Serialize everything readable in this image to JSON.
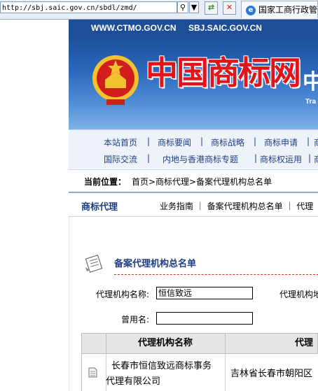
{
  "browser": {
    "address": "http://sbj.saic.gov.cn/sbdl/zmd/",
    "tab_title": "国家工商行政管理总局"
  },
  "header": {
    "url1": "WWW.CTMO.GOV.CN",
    "url2": "SBJ.SAIC.GOV.CN",
    "logo_text": "中国商标网",
    "logo_extra": "中",
    "logo_sub": "Tra"
  },
  "nav": {
    "row1": [
      "本站首页",
      "商标要闻",
      "商标战略",
      "商标申请",
      "商"
    ],
    "row2": [
      "国际交流",
      "内地与香港商标专题",
      "商标权运用",
      "商"
    ]
  },
  "breadcrumb": {
    "label": "当前位置：",
    "path": "首页>商标代理>备案代理机构总名单"
  },
  "section": {
    "title": "商标代理",
    "links": "业务指南 ｜ 备案代理机构总名单 ｜ 代理"
  },
  "list": {
    "title": "备案代理机构总名单"
  },
  "form": {
    "name_label": "代理机构名称:",
    "name_value": "恒信致远",
    "addr_label": "代理机构地",
    "former_label": "曾用名:",
    "former_value": ""
  },
  "table": {
    "headers": [
      "代理机构名称",
      "代理"
    ],
    "rows": [
      {
        "name_line1": "长春市恒信致远商标事务",
        "name_line2": "代理有限公司",
        "address": "吉林省长春市朝阳区"
      }
    ]
  },
  "colors": {
    "brand_blue": "#1e4e97",
    "logo_red": "#e0141b"
  }
}
